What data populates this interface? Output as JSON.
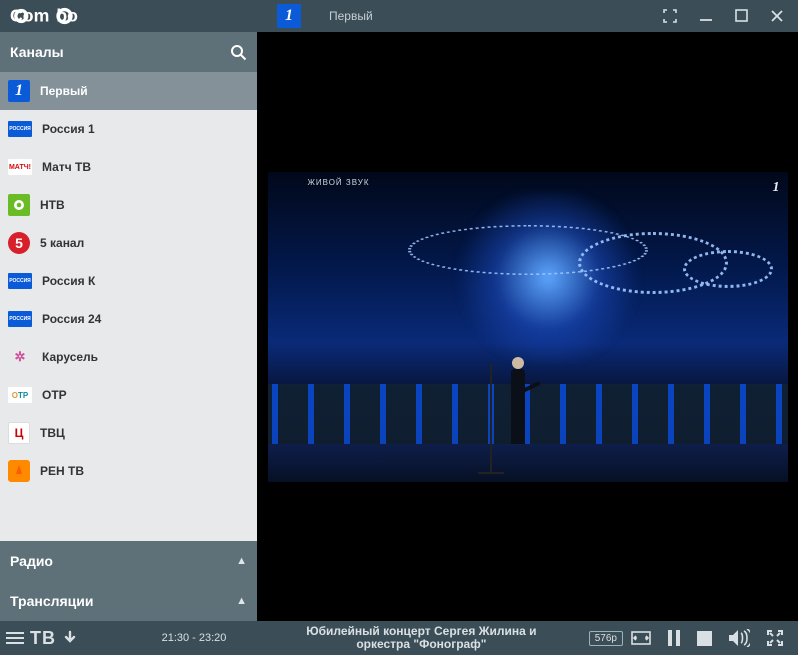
{
  "app": {
    "name": "ComboPlayer"
  },
  "titlebar": {
    "channel_name": "Первый"
  },
  "sidebar": {
    "sections": {
      "channels_label": "Каналы",
      "radio_label": "Радио",
      "streams_label": "Трансляции"
    },
    "channels": [
      {
        "name": "Первый",
        "active": true,
        "bg": "#0b5bd8",
        "tag": "1",
        "square": true
      },
      {
        "name": "Россия 1",
        "active": false,
        "bg": "#0b5bd8",
        "tag": "РОССИЯ"
      },
      {
        "name": "Матч ТВ",
        "active": false,
        "bg": "#ffffff",
        "tag": "МАТЧ!",
        "fg": "#d40c0c"
      },
      {
        "name": "НТВ",
        "active": false,
        "bg": "#6bbb27",
        "tag": "",
        "square": true
      },
      {
        "name": "5 канал",
        "active": false,
        "bg": "#d8202a",
        "tag": "5",
        "square": true
      },
      {
        "name": "Россия К",
        "active": false,
        "bg": "#0b5bd8",
        "tag": "РОССИЯ"
      },
      {
        "name": "Россия 24",
        "active": false,
        "bg": "#0b5bd8",
        "tag": "РОССИЯ"
      },
      {
        "name": "Карусель",
        "active": false,
        "bg": "#ffffff",
        "tag": "✿",
        "fg": "#d3509b"
      },
      {
        "name": "ОТР",
        "active": false,
        "bg": "#ffffff",
        "tag": "ОТР",
        "fg": "#0a8aa8"
      },
      {
        "name": "ТВЦ",
        "active": false,
        "bg": "#ffffff",
        "tag": "Ц",
        "fg": "#c00",
        "square": true
      },
      {
        "name": "РЕН ТВ",
        "active": false,
        "bg": "#ff8a00",
        "tag": "",
        "square": true
      }
    ]
  },
  "player": {
    "live_watermark": "ЖИВОЙ ЗВУК"
  },
  "controls": {
    "tv_label": "ТВ",
    "time_slot": "21:30 - 23:20",
    "program_title_line1": "Юбилейный концерт Сергея Жилина и",
    "program_title_line2": "оркестра \"Фонограф\"",
    "resolution": "576p"
  }
}
